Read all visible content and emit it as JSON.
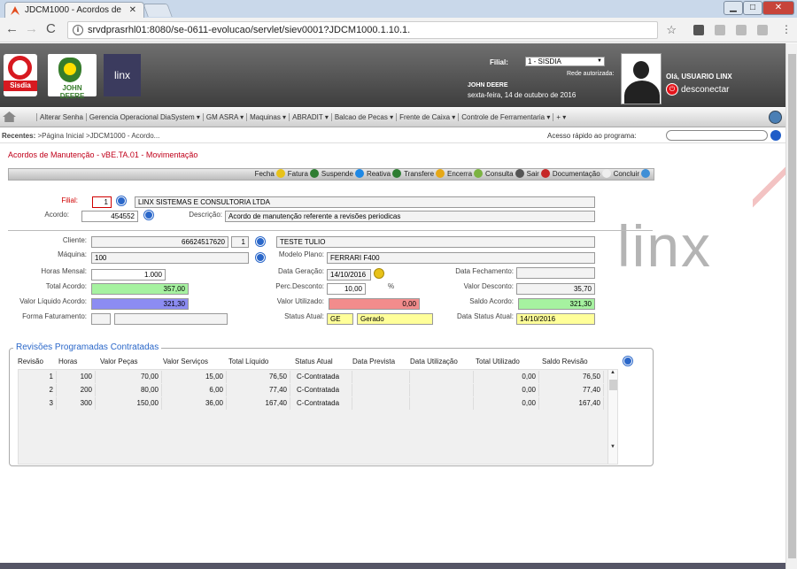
{
  "browser": {
    "tab_title": "JDCM1000 - Acordos de",
    "url": "srvdprasrhl01:8080/se-0611-evolucao/servlet/siev0001?JDCM1000.1.10.1."
  },
  "header": {
    "logo_sisdia": "Sisdia",
    "logo_jd": "JOHN DEERE",
    "logo_linx": "linx",
    "filial_label": "Filial:",
    "filial_value": "1 - SISDIA",
    "rede": "Rede autorizada:",
    "user": "JOHN DEERE",
    "date": "sexta-feira, 14 de outubro de 2016",
    "greeting": "Olá, USUARIO LINX",
    "logout": "desconectar"
  },
  "menu": [
    "Alterar Senha",
    "Gerencia Operacional DiaSystem ▾",
    "GM ASRA ▾",
    "Maquinas ▾",
    "ABRADIT ▾",
    "Balcao de Pecas ▾",
    "Frente de Caixa ▾",
    "Controle de Ferramentaria ▾",
    "+ ▾"
  ],
  "recent": {
    "label": "Recentes:",
    "path": ">Página Inicial >JDCM1000 - Acordo...",
    "quick_label": "Acesso rápido ao programa:"
  },
  "page_title": "Acordos de Manutenção - vBE.TA.01 - Movimentação",
  "toolbar": [
    "Fecha",
    "Fatura",
    "Suspende",
    "Reativa",
    "Transfere",
    "Encerra",
    "Consulta",
    "Sair",
    "Documentação",
    "Concluir"
  ],
  "toolbar_colors": [
    "#e8c21a",
    "#2e7d32",
    "#1e88e5",
    "#2e7d32",
    "#e6a817",
    "#7cb342",
    "#555555",
    "#c62828",
    "#eeeeee",
    "#3f8fd6"
  ],
  "form": {
    "filial_label": "Filial:",
    "filial_value": "1",
    "company": "LINX SISTEMAS E CONSULTORIA LTDA",
    "acordo_label": "Acordo:",
    "acordo_value": "454552",
    "descricao_label": "Descrição:",
    "descricao_value": "Acordo de manutenção referente a revisões periodicas",
    "cliente_label": "Cliente:",
    "cliente_value": "66624517620",
    "cliente_seq": "1",
    "cliente_name": "TESTE TULIO",
    "maquina_label": "Máquina:",
    "maquina_value": "100",
    "modelo_label": "Modelo Plano:",
    "modelo_value": "FERRARI F400",
    "horas_label": "Horas Mensal:",
    "horas_value": "1.000",
    "data_geracao_label": "Data Geração:",
    "data_geracao_value": "14/10/2016",
    "data_fech_label": "Data Fechamento:",
    "data_fech_value": "",
    "total_label": "Total Acordo:",
    "total_value": "357,00",
    "perc_label": "Perc.Desconto:",
    "perc_value": "10,00",
    "perc_unit": "%",
    "valor_desc_label": "Valor Desconto:",
    "valor_desc_value": "35,70",
    "liquido_label": "Valor Líquido Acordo:",
    "liquido_value": "321,30",
    "utilizado_label": "Valor Utilizado:",
    "utilizado_value": "0,00",
    "saldo_label": "Saldo Acordo:",
    "saldo_value": "321,30",
    "forma_label": "Forma Faturamento:",
    "forma_code": "",
    "forma_value": "",
    "status_label": "Status Atual:",
    "status_code": "GE",
    "status_value": "Gerado",
    "data_status_label": "Data Status Atual:",
    "data_status_value": "14/10/2016"
  },
  "grid": {
    "title": "Revisões Programadas Contratadas",
    "columns": [
      "Revisão",
      "Horas",
      "Valor Peças",
      "Valor Serviços",
      "Total Líquido",
      "Status Atual",
      "Data Prevista",
      "Data Utilização",
      "Total Utilizado",
      "Saldo Revisão"
    ],
    "rows": [
      [
        "1",
        "100",
        "70,00",
        "15,00",
        "76,50",
        "C-Contratada",
        "",
        "",
        "0,00",
        "76,50"
      ],
      [
        "2",
        "200",
        "80,00",
        "6,00",
        "77,40",
        "C-Contratada",
        "",
        "",
        "0,00",
        "77,40"
      ],
      [
        "3",
        "300",
        "150,00",
        "36,00",
        "167,40",
        "C-Contratada",
        "",
        "",
        "0,00",
        "167,40"
      ]
    ]
  },
  "watermark": "linx",
  "colors": {
    "title_red": "#c0001a",
    "total_green": "#a6f2a0",
    "liquido_blue": "#8c8cf2",
    "utilizado_red": "#f28c8c",
    "yellow": "#ffff99"
  }
}
